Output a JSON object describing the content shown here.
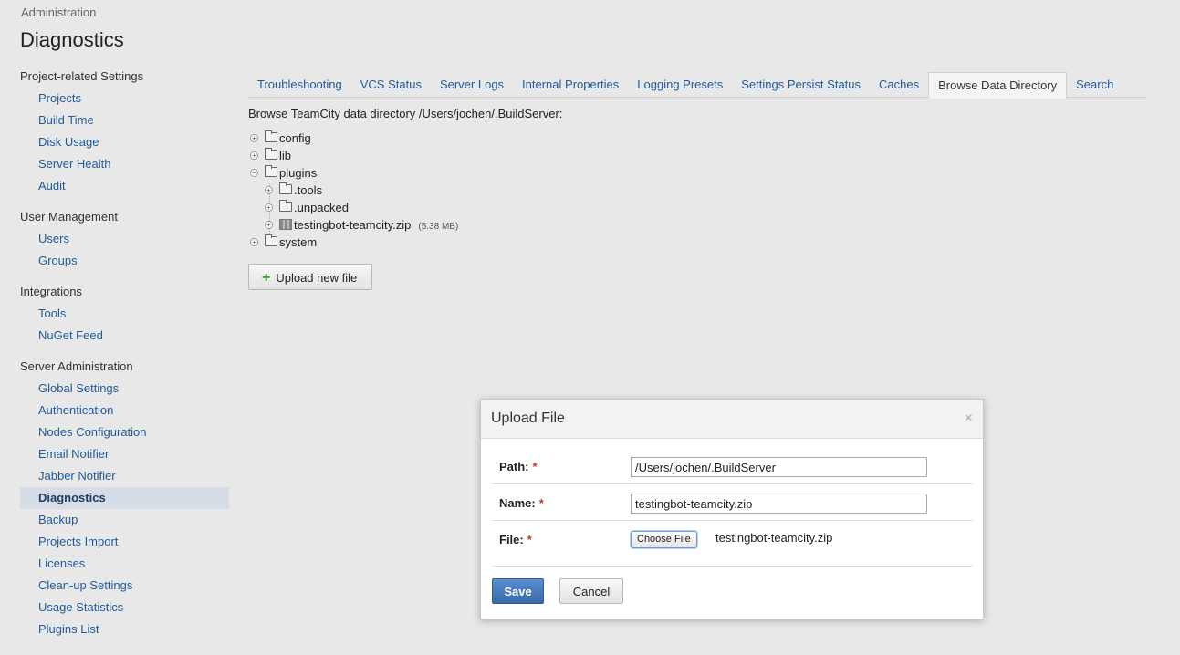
{
  "breadcrumb": "Administration",
  "page_title": "Diagnostics",
  "sidebar": {
    "groups": [
      {
        "title": "Project-related Settings",
        "items": [
          "Projects",
          "Build Time",
          "Disk Usage",
          "Server Health",
          "Audit"
        ]
      },
      {
        "title": "User Management",
        "items": [
          "Users",
          "Groups"
        ]
      },
      {
        "title": "Integrations",
        "items": [
          "Tools",
          "NuGet Feed"
        ]
      },
      {
        "title": "Server Administration",
        "items": [
          "Global Settings",
          "Authentication",
          "Nodes Configuration",
          "Email Notifier",
          "Jabber Notifier",
          "Diagnostics",
          "Backup",
          "Projects Import",
          "Licenses",
          "Clean-up Settings",
          "Usage Statistics",
          "Plugins List"
        ]
      }
    ],
    "active_item": "Diagnostics"
  },
  "tabs": {
    "items": [
      "Troubleshooting",
      "VCS Status",
      "Server Logs",
      "Internal Properties",
      "Logging Presets",
      "Settings Persist Status",
      "Caches",
      "Browse Data Directory",
      "Search"
    ],
    "active": "Browse Data Directory"
  },
  "browse": {
    "label": "Browse TeamCity data directory /Users/jochen/.BuildServer:",
    "tree": [
      {
        "name": "config",
        "type": "folder",
        "expanded": false,
        "level": 0
      },
      {
        "name": "lib",
        "type": "folder",
        "expanded": false,
        "level": 0
      },
      {
        "name": "plugins",
        "type": "folder",
        "expanded": true,
        "level": 0
      },
      {
        "name": ".tools",
        "type": "folder",
        "expanded": false,
        "level": 1
      },
      {
        "name": ".unpacked",
        "type": "folder",
        "expanded": false,
        "level": 1
      },
      {
        "name": "testingbot-teamcity.zip",
        "type": "zip",
        "expanded": false,
        "level": 1,
        "size": "(5.38 MB)"
      },
      {
        "name": "system",
        "type": "folder",
        "expanded": false,
        "level": 0
      }
    ],
    "upload_button": "Upload new file"
  },
  "dialog": {
    "title": "Upload File",
    "close_glyph": "×",
    "path_label": "Path:",
    "path_value": "/Users/jochen/.BuildServer",
    "name_label": "Name:",
    "name_value": "testingbot-teamcity.zip",
    "file_label": "File:",
    "choose_file_label": "Choose File",
    "file_name": "testingbot-teamcity.zip",
    "required_mark": "*",
    "save_label": "Save",
    "cancel_label": "Cancel"
  },
  "colors": {
    "link": "#1f5b9c",
    "active_bg": "#d6dde6",
    "primary_button": "#3869aa",
    "required": "#c0392b"
  }
}
